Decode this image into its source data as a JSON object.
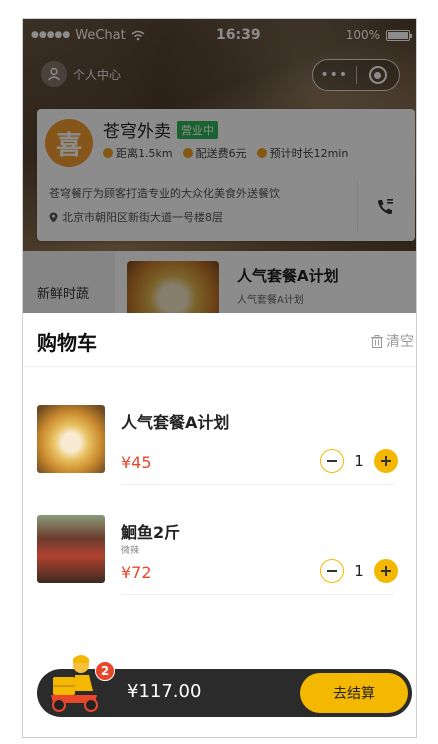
{
  "status_bar": {
    "carrier": "WeChat",
    "signal_dots": "●●●●●",
    "time": "16:39",
    "battery": "100%"
  },
  "nav": {
    "user_center_label": "个人中心",
    "more_label": "•••"
  },
  "shop": {
    "logo_glyph": "喜",
    "name": "苍穹外卖",
    "status_badge": "营业中",
    "distance": "距离1.5km",
    "delivery_fee": "配送费6元",
    "eta": "预计时长12min",
    "description": "苍穹餐厅为顾客打造专业的大众化美食外送餐饮",
    "address": "北京市朝阳区新街大道一号楼8层"
  },
  "menu": {
    "category": "新鲜时蔬",
    "dish_title": "人气套餐A计划",
    "dish_subtitle": "人气套餐A计划"
  },
  "cart": {
    "title": "购物车",
    "clear_label": "清空",
    "items": [
      {
        "name": "人气套餐A计划",
        "spec": "",
        "price": "¥45",
        "qty": "1"
      },
      {
        "name": "鮰鱼2斤",
        "spec": "微辣",
        "price": "¥72",
        "qty": "1"
      }
    ]
  },
  "bottom_bar": {
    "badge_count": "2",
    "total": "¥117.00",
    "checkout_label": "去结算"
  },
  "colors": {
    "accent": "#f5b800",
    "price": "#e8472c",
    "open_badge": "#2fb45a",
    "bar": "#2b2b2b"
  }
}
